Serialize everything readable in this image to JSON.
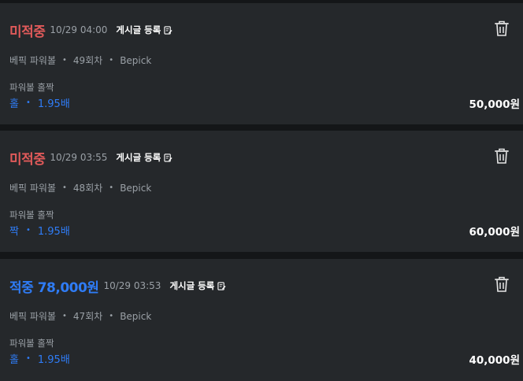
{
  "bets": [
    {
      "status": "미적중",
      "status_type": "miss",
      "time": "10/29 04:00",
      "post_label": "게시글 등록",
      "game": "베픽 파워볼",
      "round": "49회차",
      "site": "Bepick",
      "bet_type": "파워볼 홀짝",
      "pick": "홀",
      "odds": "1.95배",
      "amount": "50,000원"
    },
    {
      "status": "미적중",
      "status_type": "miss",
      "time": "10/29 03:55",
      "post_label": "게시글 등록",
      "game": "베픽 파워볼",
      "round": "48회차",
      "site": "Bepick",
      "bet_type": "파워볼 홀짝",
      "pick": "짝",
      "odds": "1.95배",
      "amount": "60,000원"
    },
    {
      "status": "적중 78,000원",
      "status_type": "hit",
      "time": "10/29 03:53",
      "post_label": "게시글 등록",
      "game": "베픽 파워볼",
      "round": "47회차",
      "site": "Bepick",
      "bet_type": "파워볼 홀짝",
      "pick": "홀",
      "odds": "1.95배",
      "amount": "40,000원"
    }
  ],
  "separator": "•",
  "colors": {
    "miss": "#e05a5a",
    "hit": "#2f7cf6",
    "card_bg": "#25282b",
    "page_bg": "#141618"
  },
  "icons": {
    "post": "edit-note-icon",
    "delete": "trash-icon"
  }
}
